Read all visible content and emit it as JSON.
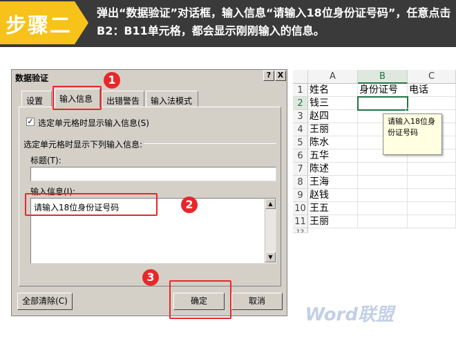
{
  "banner": {
    "step": "步骤二",
    "description": "弹出“数据验证”对话框，输入信息“请输入18位身份证号码”，任意点击B2：B11单元格，都会显示刚刚输入的信息。",
    "accent_color": "#f7c21a"
  },
  "dialog": {
    "title": "数据验证",
    "help_button": "?",
    "close_button": "X",
    "tabs": [
      "设置",
      "输入信息",
      "出错警告",
      "输入法模式"
    ],
    "active_tab": "输入信息",
    "show_checkbox_label": "选定单元格时显示输入信息(S)",
    "show_checkbox_checked": true,
    "section_label": "选定单元格时显示下列输入信息:",
    "title_label": "标题(T):",
    "title_value": "",
    "message_label": "输入信息(I):",
    "message_value": "请输入18位身份证号码",
    "clear_button": "全部清除(C)",
    "ok_button": "确定",
    "cancel_button": "取消"
  },
  "annotations": [
    "1",
    "2",
    "3"
  ],
  "sheet": {
    "columns": [
      "A",
      "B",
      "C"
    ],
    "rows": [
      "1",
      "2",
      "3",
      "4",
      "5",
      "6",
      "7",
      "8",
      "9",
      "10",
      "11",
      "12"
    ],
    "header_row": [
      "姓名",
      "身份证号",
      "电话"
    ],
    "names": [
      "钱三",
      "赵四",
      "王丽",
      "陈水",
      "五华",
      "陈述",
      "王海",
      "赵钱",
      "王五",
      "王丽"
    ],
    "tooltip": "请输入18位身份证号码"
  },
  "watermark": "Word联盟"
}
